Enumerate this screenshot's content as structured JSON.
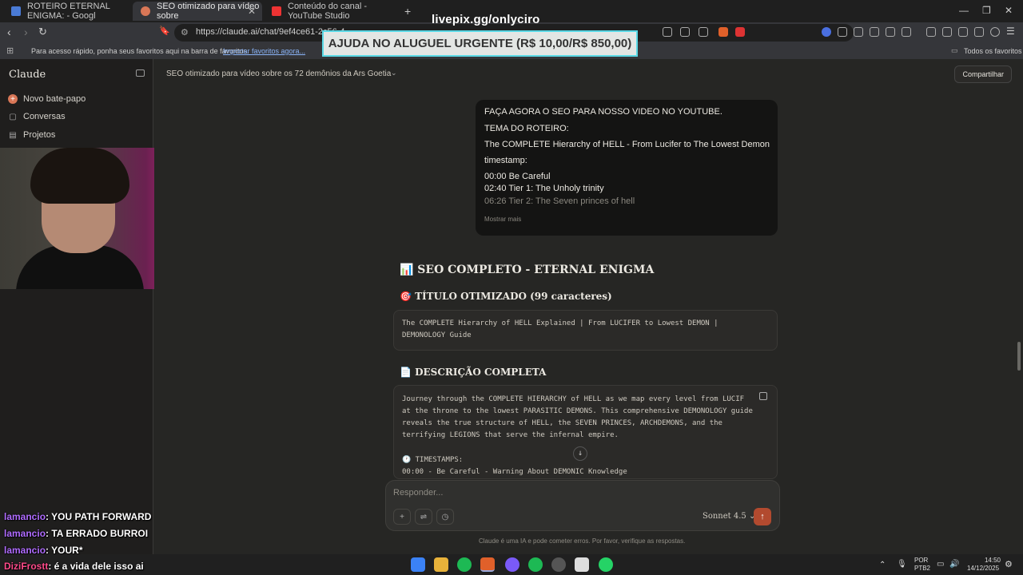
{
  "browser": {
    "tabs": [
      {
        "title": "ROTEIRO ETERNAL ENIGMA: - Googl",
        "favicon_color": "#4a7bd6"
      },
      {
        "title": "SEO otimizado para vídeo sobre",
        "favicon_color": "#d97757"
      },
      {
        "title": "Conteúdo do canal - YouTube Studio",
        "favicon_color": "#e33"
      }
    ],
    "new_tab": "+",
    "url": "https://claude.ai/chat/9ef4ce61-2c56-4",
    "bookmarks_text": "Para acesso rápido, ponha seus favoritos aqui na barra de favoritos.",
    "bookmarks_link": "Importar favoritos agora...",
    "all_bookmarks": "Todos os favoritos"
  },
  "overlay": {
    "livepix": "livepix.gg/onlyciro",
    "banner": "AJUDA NO ALUGUEL URGENTE (R$ 10,00/R$ 850,00)"
  },
  "sidebar": {
    "brand": "Claude",
    "items": [
      {
        "label": "Novo bate-papo",
        "icon": "plus-circle-icon"
      },
      {
        "label": "Conversas",
        "icon": "chat-bubble-icon"
      },
      {
        "label": "Projetos",
        "icon": "folder-icon"
      }
    ]
  },
  "chat": {
    "title": "SEO otimizado para vídeo sobre os 72 demônios da Ars Goetia",
    "share": "Compartilhar",
    "user_message": {
      "lines": [
        "FAÇA AGORA O SEO PARA NOSSO VIDEO NO YOUTUBE.",
        "TEMA DO ROTEIRO:",
        "The COMPLETE Hierarchy of HELL - From Lucifer to The Lowest Demon",
        "timestamp:",
        "00:00 Be Careful",
        "02:40 Tier 1: The Unholy trinity",
        "06:26 Tier 2: The Seven princes of hell"
      ],
      "show_more": "Mostrar mais"
    },
    "response": {
      "heading": "📊 SEO COMPLETO - ETERNAL ENIGMA",
      "title_heading": "🎯 TÍTULO OTIMIZADO (99 caracteres)",
      "title_code": [
        "The COMPLETE Hierarchy of HELL Explained | From LUCIFER to Lowest DEMON |",
        "DEMONOLOGY Guide"
      ],
      "desc_heading": "📄 DESCRIÇÃO COMPLETA",
      "desc_code": [
        "Journey through the COMPLETE HIERARCHY of HELL as we map every level from LUCIF",
        "at the throne to the lowest PARASITIC DEMONS. This comprehensive DEMONOLOGY guide",
        "reveals the true structure of HELL, the SEVEN PRINCES, ARCHDEMONS, and the",
        "terrifying LEGIONS that serve the infernal empire.",
        "",
        "🕐 TIMESTAMPS:",
        "00:00 - Be Careful - Warning About DEMONIC Knowledge"
      ]
    },
    "composer": {
      "placeholder": "Responder...",
      "model": "Sonnet 4.5"
    },
    "disclaimer": "Claude é uma IA e pode cometer erros. Por favor, verifique as respostas."
  },
  "stream_chat": [
    {
      "user": "lamancio",
      "text": ": YOU PATH FORWARD"
    },
    {
      "user": "lamancio",
      "text": ": TA ERRADO BURROI"
    },
    {
      "user": "lamancio",
      "text": ": YOUR*"
    },
    {
      "user": "DiziFrostt",
      "text": ": é a vida dele isso ai"
    }
  ],
  "taskbar": {
    "lang": "POR",
    "lang2": "PTB2",
    "time": "14:50",
    "date": "14/12/2025"
  }
}
